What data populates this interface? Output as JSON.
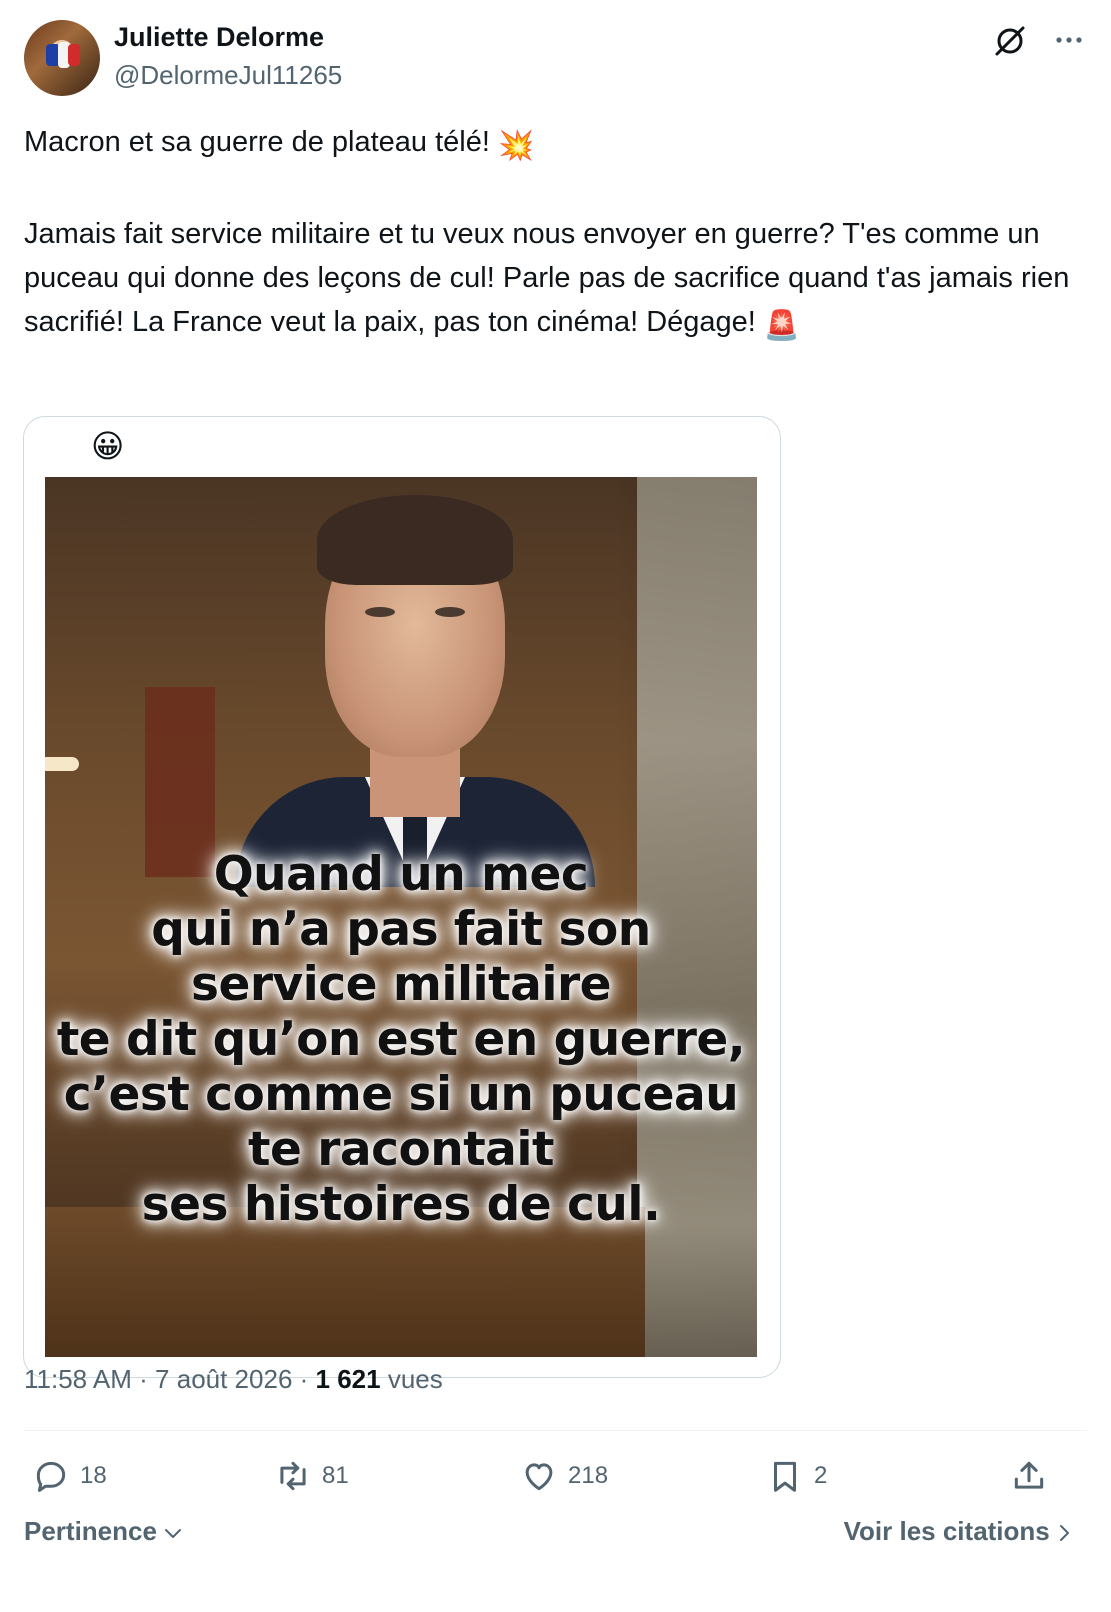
{
  "author": {
    "name": "Juliette Delorme",
    "handle": "@DelormeJul11265"
  },
  "icons": {
    "grok": "grok-icon",
    "more": "more-icon",
    "reply": "reply-icon",
    "repost": "repost-icon",
    "like": "heart-icon",
    "bookmark": "bookmark-icon",
    "share": "share-icon"
  },
  "post": {
    "line1": "Macron et sa guerre de plateau télé! ",
    "line1_emoji": "💥",
    "body": "Jamais fait service militaire et tu veux nous envoyer en guerre? T'es comme un puceau qui donne des leçons de cul! Parle pas de sacrifice quand t'as jamais rien sacrifié! La France veut la paix, pas ton cinéma! Dégage! ",
    "body_emoji": "🚨"
  },
  "media": {
    "top_emoji": "😀",
    "quote_lines": [
      "Quand un mec",
      "qui n’a pas fait son",
      "service militaire",
      "te dit qu’on est en guerre,",
      "c’est comme si un puceau",
      "te racontait",
      "ses histoires de cul."
    ]
  },
  "meta": {
    "time": "11:58 AM",
    "sep1": " · ",
    "date": "7 août 2026",
    "sep2": " · ",
    "views_count": "1 621",
    "views_label": " vues"
  },
  "actions": {
    "replies": "18",
    "reposts": "81",
    "likes": "218",
    "bookmarks": "2"
  },
  "footer": {
    "sort_label": "Pertinence",
    "quotes_label": "Voir les citations"
  },
  "colors": {
    "text_primary": "#0f1419",
    "text_secondary": "#536471",
    "border": "#cfd9de"
  }
}
